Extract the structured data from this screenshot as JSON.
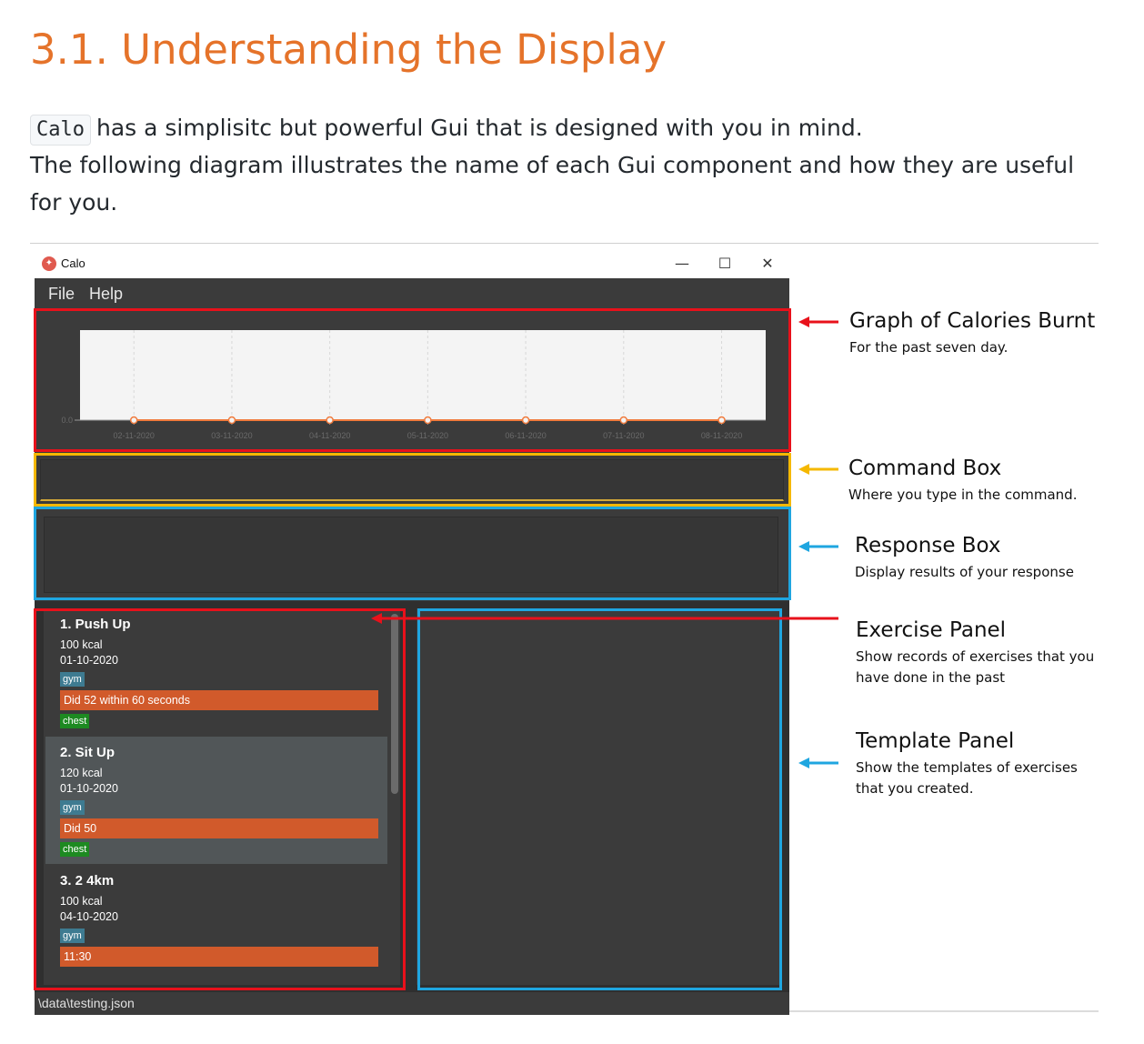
{
  "doc": {
    "heading": "3.1. Understanding the Display",
    "app_code": "Calo",
    "intro_rest": "has a simplisitc but powerful Gui that is designed with you in mind.",
    "intro_line2": "The following diagram illustrates the name of each Gui component and how they are useful for you."
  },
  "window": {
    "title": "Calo",
    "minimize": "—",
    "maximize": "☐",
    "close": "✕",
    "menu": [
      "File",
      "Help"
    ],
    "status_path": "\\data\\testing.json"
  },
  "chart_data": {
    "type": "line",
    "x": [
      "02-11-2020",
      "03-11-2020",
      "04-11-2020",
      "05-11-2020",
      "06-11-2020",
      "07-11-2020",
      "08-11-2020"
    ],
    "values": [
      0,
      0,
      0,
      0,
      0,
      0,
      0
    ],
    "y_tick_label": "0.0",
    "grid": "vertical",
    "line_color": "#f07a3c"
  },
  "exercises": [
    {
      "name": "1.  Push Up",
      "calories": "100  kcal",
      "date": "01-10-2020",
      "tag1": "gym",
      "description": "Did 52 within 60 seconds",
      "tag2": "chest"
    },
    {
      "name": "2.  Sit Up",
      "calories": "120  kcal",
      "date": "01-10-2020",
      "tag1": "gym",
      "description": "Did 50",
      "tag2": "chest"
    },
    {
      "name": "3.  2 4km",
      "calories": "100  kcal",
      "date": "04-10-2020",
      "tag1": "gym",
      "description": "11:30",
      "tag2": ""
    }
  ],
  "annotations": {
    "graph": {
      "title": "Graph of Calories Burnt",
      "desc": "For the past seven day."
    },
    "command": {
      "title": "Command Box",
      "desc": "Where you type in the command."
    },
    "response": {
      "title": "Response Box",
      "desc": "Display results of your response"
    },
    "exercise": {
      "title": "Exercise Panel",
      "desc": "Show records of exercises that you have done in the past"
    },
    "template": {
      "title": "Template Panel",
      "desc": "Show the templates of exercises that you created."
    }
  },
  "colors": {
    "heading": "#e5732a",
    "red_frame": "#e8111b",
    "yellow_frame": "#f5b800",
    "blue_frame": "#1fa6e0"
  }
}
